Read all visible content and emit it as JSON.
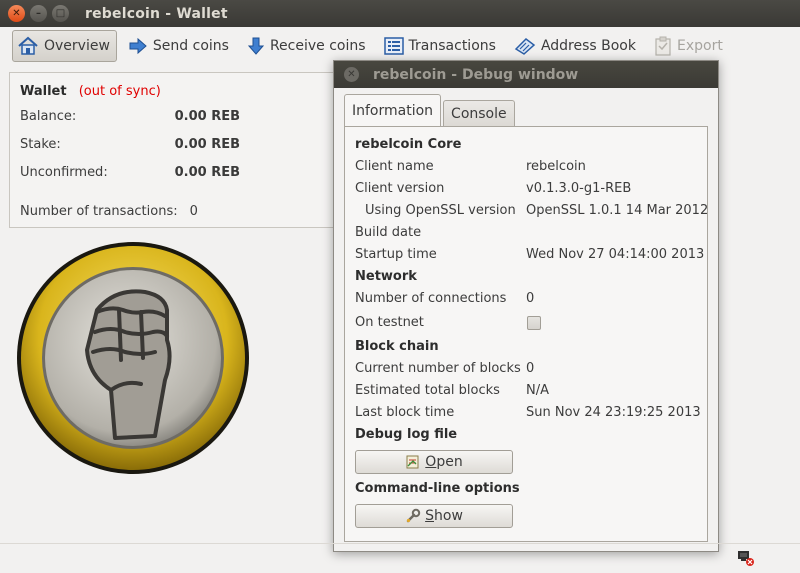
{
  "window": {
    "title": "rebelcoin - Wallet"
  },
  "toolbar": {
    "overview": "Overview",
    "send": "Send coins",
    "receive": "Receive coins",
    "transactions": "Transactions",
    "address_book": "Address Book",
    "export": "Export"
  },
  "wallet": {
    "title": "Wallet",
    "sync_status": "(out of sync)",
    "balance_label": "Balance:",
    "balance_value": "0.00 REB",
    "stake_label": "Stake:",
    "stake_value": "0.00 REB",
    "unconfirmed_label": "Unconfirmed:",
    "unconfirmed_value": "0.00 REB",
    "ntx_label": "Number of transactions:",
    "ntx_value": "0"
  },
  "debug": {
    "title": "rebelcoin - Debug window",
    "tabs": [
      "Information",
      "Console"
    ],
    "core_heading": "rebelcoin Core",
    "client_name_label": "Client name",
    "client_name": "rebelcoin",
    "client_version_label": "Client version",
    "client_version": "v0.1.3.0-g1-REB",
    "openssl_label": "Using OpenSSL version",
    "openssl": "OpenSSL 1.0.1 14 Mar 2012",
    "build_date_label": "Build date",
    "startup_label": "Startup time",
    "startup": "Wed Nov 27 04:14:00 2013",
    "network_heading": "Network",
    "connections_label": "Number of connections",
    "connections": "0",
    "testnet_label": "On testnet",
    "blockchain_heading": "Block chain",
    "blocks_label": "Current number of blocks",
    "blocks": "0",
    "est_blocks_label": "Estimated total blocks",
    "est_blocks": "N/A",
    "last_block_label": "Last block time",
    "last_block": "Sun Nov 24 23:19:25 2013",
    "debuglog_heading": "Debug log file",
    "open_button_first": "O",
    "open_button_rest": "pen",
    "cmdline_heading": "Command-line options",
    "show_button_first": "S",
    "show_button_rest": "how"
  }
}
